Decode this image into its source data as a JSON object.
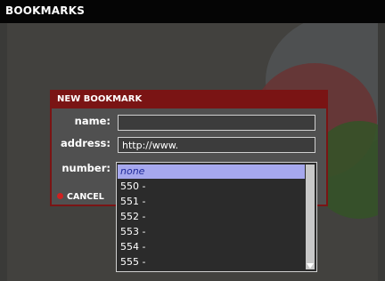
{
  "header": {
    "title": "BOOKMARKS"
  },
  "dialog": {
    "title": "NEW BOOKMARK",
    "fields": {
      "name": {
        "label": "name:",
        "value": ""
      },
      "address": {
        "label": "address:",
        "value": "http://www."
      },
      "number": {
        "label": "number:",
        "value": "none"
      }
    },
    "cancel_label": "CANCEL"
  },
  "dropdown": {
    "options": [
      "none",
      "550 -",
      "551 -",
      "552 -",
      "553 -",
      "554 -",
      "555 -"
    ]
  },
  "icons": {
    "cancel": "red-circle",
    "scroll": "triangle-down"
  },
  "colors": {
    "dialog_border": "#7a1414",
    "selected_bg": "#a6a8ee",
    "selected_text": "#1f2a9a",
    "cancel_dot": "#d02020"
  }
}
